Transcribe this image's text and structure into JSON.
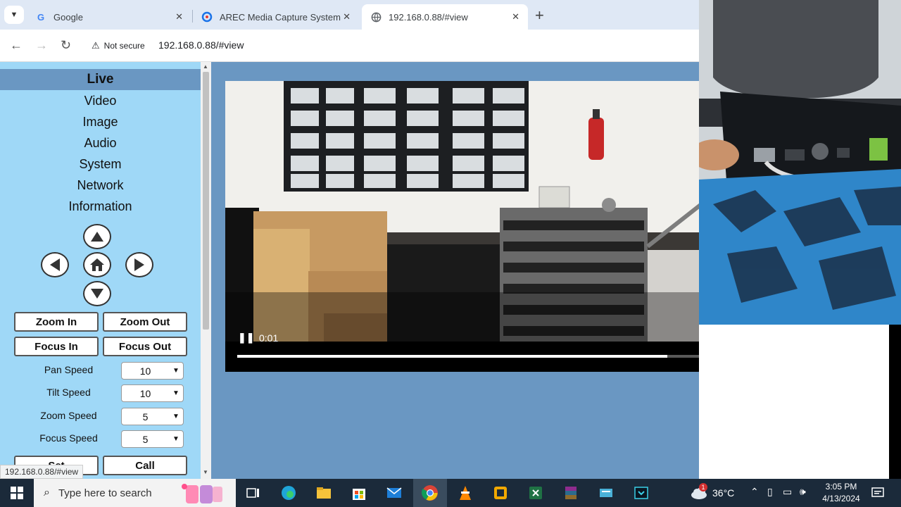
{
  "browser": {
    "tabs": [
      {
        "title": "Google",
        "icon": "google-icon"
      },
      {
        "title": "AREC Media Capture System",
        "icon": "arec-icon"
      },
      {
        "title": "192.168.0.88/#view",
        "icon": "globe-icon"
      }
    ],
    "security_label": "Not secure",
    "url": "192.168.0.88/#view"
  },
  "sidebar": {
    "menu": [
      "Live",
      "Video",
      "Image",
      "Audio",
      "System",
      "Network",
      "Information"
    ],
    "active_item": "Live",
    "buttons": {
      "zoom_in": "Zoom In",
      "zoom_out": "Zoom Out",
      "focus_in": "Focus In",
      "focus_out": "Focus Out",
      "set": "Set",
      "call": "Call"
    },
    "speeds": [
      {
        "label": "Pan Speed",
        "value": "10"
      },
      {
        "label": "Tilt Speed",
        "value": "10"
      },
      {
        "label": "Zoom Speed",
        "value": "5"
      },
      {
        "label": "Focus Speed",
        "value": "5"
      }
    ]
  },
  "video": {
    "time": "0:01",
    "progress": 0.89,
    "state": "playing"
  },
  "status_bar_url": "192.168.0.88/#view",
  "taskbar": {
    "search_placeholder": "Type here to search",
    "temperature": "36°C",
    "time": "3:05 PM",
    "date": "4/13/2024",
    "weather_badge": "1"
  },
  "colors": {
    "sidebar_bg": "#9fd8f7",
    "page_bg": "#6a97c2",
    "active_menu_bg": "#6a97c2"
  }
}
